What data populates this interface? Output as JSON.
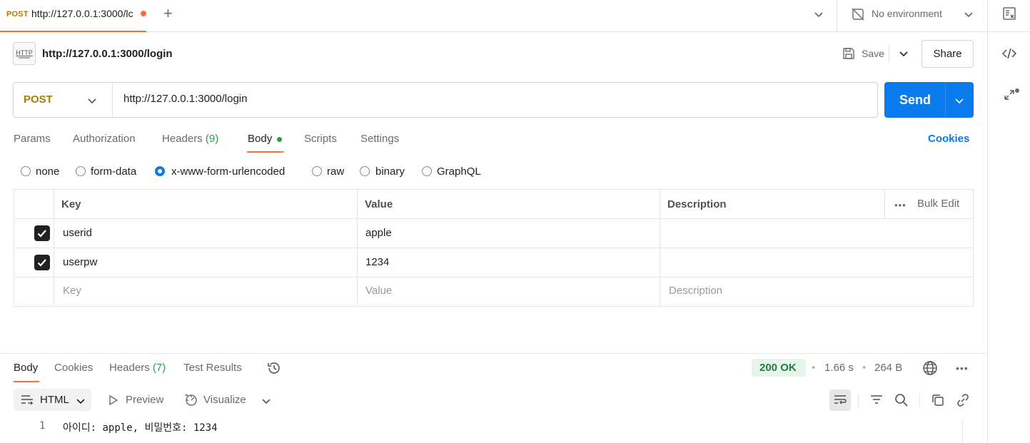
{
  "tabs": [
    {
      "method": "POST",
      "title": "http://127.0.0.1:3000/lc",
      "unsaved": true
    }
  ],
  "environment": {
    "label": "No environment"
  },
  "request": {
    "title": "http://127.0.0.1:3000/login",
    "save_label": "Save",
    "share_label": "Share",
    "method": "POST",
    "url": "http://127.0.0.1:3000/login",
    "send_label": "Send"
  },
  "request_tabs": {
    "params": "Params",
    "authorization": "Authorization",
    "headers": "Headers",
    "headers_count": "(9)",
    "body": "Body",
    "scripts": "Scripts",
    "settings": "Settings",
    "cookies": "Cookies"
  },
  "body_types": {
    "options": [
      "none",
      "form-data",
      "x-www-form-urlencoded",
      "raw",
      "binary",
      "GraphQL"
    ],
    "selected": "x-www-form-urlencoded"
  },
  "params_table": {
    "headers": {
      "key": "Key",
      "value": "Value",
      "description": "Description",
      "bulk_edit": "Bulk Edit"
    },
    "rows": [
      {
        "checked": true,
        "key": "userid",
        "value": "apple",
        "description": ""
      },
      {
        "checked": true,
        "key": "userpw",
        "value": "1234",
        "description": ""
      }
    ],
    "placeholders": {
      "key": "Key",
      "value": "Value",
      "description": "Description"
    }
  },
  "response": {
    "tabs": {
      "body": "Body",
      "cookies": "Cookies",
      "headers": "Headers",
      "headers_count": "(7)",
      "test_results": "Test Results"
    },
    "status": "200 OK",
    "time": "1.66 s",
    "size": "264 B",
    "format": "HTML",
    "preview_label": "Preview",
    "visualize_label": "Visualize",
    "lines": [
      {
        "num": "1",
        "text": "아이디: apple, 비밀번호: 1234"
      }
    ]
  },
  "colors": {
    "accent": "#ff6c37",
    "send": "#097bed",
    "method_post": "#a97c05",
    "status_ok": "#1e7f35"
  }
}
